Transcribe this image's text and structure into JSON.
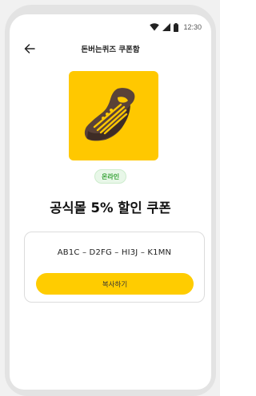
{
  "status_bar": {
    "time": "12:30",
    "icons": [
      "wifi-icon",
      "signal-icon",
      "battery-icon"
    ]
  },
  "app_bar": {
    "back_icon": "arrow-left-icon",
    "title": "돈버는퀴즈 쿠폰함"
  },
  "coupon": {
    "image_icon": "sneaker-icon",
    "badge": "온라인",
    "title": "공식몰 5% 할인 쿠폰",
    "code": "AB1C – D2FG – HI3J – K1MN",
    "copy_label": "복사하기"
  },
  "colors": {
    "accent": "#ffcc00",
    "image_background": "#ffc800",
    "badge_text": "#3aa43a",
    "badge_background": "#e8f7e8"
  }
}
